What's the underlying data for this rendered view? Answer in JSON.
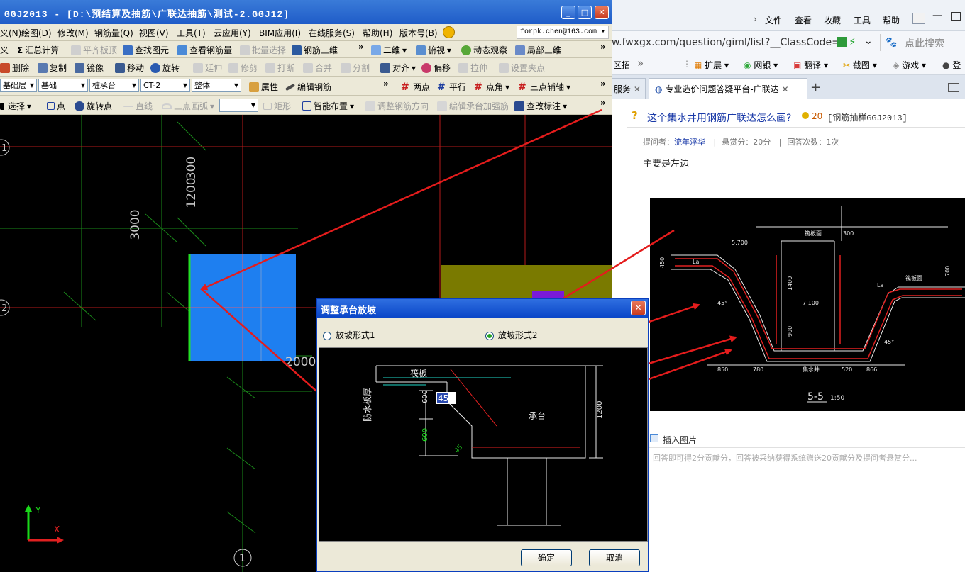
{
  "app": {
    "title": "GGJ2013 - [D:\\预结算及抽筋\\广联达抽筋\\测试-2.GGJ12]",
    "win_min": "_",
    "win_max": "□",
    "win_close": "✕",
    "menu": [
      "义(N)",
      "绘图(D)",
      "修改(M)",
      "钢筋量(Q)",
      "视图(V)",
      "工具(T)",
      "云应用(Y)",
      "BIM应用(I)",
      "在线服务(S)",
      "帮助(H)",
      "版本号(B)"
    ],
    "user": "forpk.chen@163.com",
    "toolbar1": {
      "define": "义",
      "calc": "汇总计算",
      "align_top": "平齐板顶",
      "find": "查找图元",
      "view_rebar": "查看钢筋量",
      "batch": "批量选择",
      "rebar3d": "钢筋三维",
      "more": "»",
      "view2d": "二维",
      "topview": "俯视",
      "dynamic": "动态观察",
      "local3d": "局部三维"
    },
    "toolbar2": {
      "delete": "删除",
      "copy": "复制",
      "mirror": "镜像",
      "move": "移动",
      "rotate": "旋转",
      "extend": "延伸",
      "trim": "修剪",
      "break": "打断",
      "merge": "合并",
      "split": "分割",
      "align": "对齐",
      "offset": "偏移",
      "stretch": "拉伸",
      "setpoint": "设置夹点"
    },
    "toolbar3": {
      "layer": "基础层",
      "category": "基础",
      "type": "桩承台",
      "element": "CT-2",
      "whole": "整体",
      "props": "属性",
      "edit_rebar": "编辑钢筋",
      "two_pt": "两点",
      "parallel": "平行",
      "pt_angle": "点角",
      "three_pt": "三点辅轴"
    },
    "toolbar4": {
      "select": "选择",
      "point": "点",
      "rotate_pt": "旋转点",
      "line": "直线",
      "arc": "三点画弧",
      "rect": "矩形",
      "smart": "智能布置",
      "adjust_dir": "调整钢筋方向",
      "edit_cap": "编辑承台加强筋",
      "modify_label": "查改标注"
    }
  },
  "cad": {
    "dims": {
      "d300": "300",
      "d1200": "1200",
      "d3000": "3000",
      "d2000": "2000"
    },
    "axes": {
      "a1": "1",
      "a2": "2",
      "bottom1": "1"
    },
    "ucs": {
      "y": "Y",
      "x": "X"
    }
  },
  "dialog": {
    "title": "调整承台放坡",
    "close": "✕",
    "option1": "放坡形式1",
    "option2": "放坡形式2",
    "selected": 2,
    "diagram": {
      "slab": "筏板",
      "waterproof": "防水板厚",
      "d600a": "600",
      "d600b": "600",
      "angle": "45",
      "angle_b": "45",
      "cap": "承台",
      "d1200": "1200"
    },
    "ok": "确定",
    "cancel": "取消"
  },
  "browser": {
    "menu": [
      "文件",
      "查看",
      "收藏",
      "工具",
      "帮助"
    ],
    "url": "w.fwxgx.com/question/giml/list?__ClassCode=-",
    "search_placeholder": "点此搜索",
    "ext": {
      "recruit": "区招",
      "expand": "扩展",
      "bank": "网银",
      "translate": "翻译",
      "screenshot": "截图",
      "games": "游戏",
      "login": "登"
    },
    "tabs": [
      {
        "label": "服务"
      },
      {
        "label": "专业造价问题答疑平台-广联达"
      }
    ],
    "question": {
      "title": "这个集水井用钢筋广联达怎么画?",
      "points": "20",
      "tag": "[钢筋抽样GGJ2013]",
      "asker_label": "提问者：",
      "asker": "流年浮华",
      "reward": "悬赏分：20分",
      "answers": "回答次数：1次",
      "body": "主要是左边",
      "insert_image": "插入图片",
      "hint": "回答即可得2分贡献分，回答被采纳获得系统赠送20贡献分及提问者悬赏分..."
    },
    "drawing": {
      "t1": "5.700",
      "t2": "7.100",
      "t3": "450",
      "t4": "1400",
      "t5": "300",
      "t6": "700",
      "t7": "900",
      "la": "La",
      "ang1": "45°",
      "ang2": "45°",
      "d850": "850",
      "d780": "780",
      "d520": "520",
      "d866": "866",
      "slab_l": "筏板面",
      "slab_r": "筏板面",
      "mid": "集水井",
      "section": "5-5",
      "scale": "1:50"
    }
  }
}
